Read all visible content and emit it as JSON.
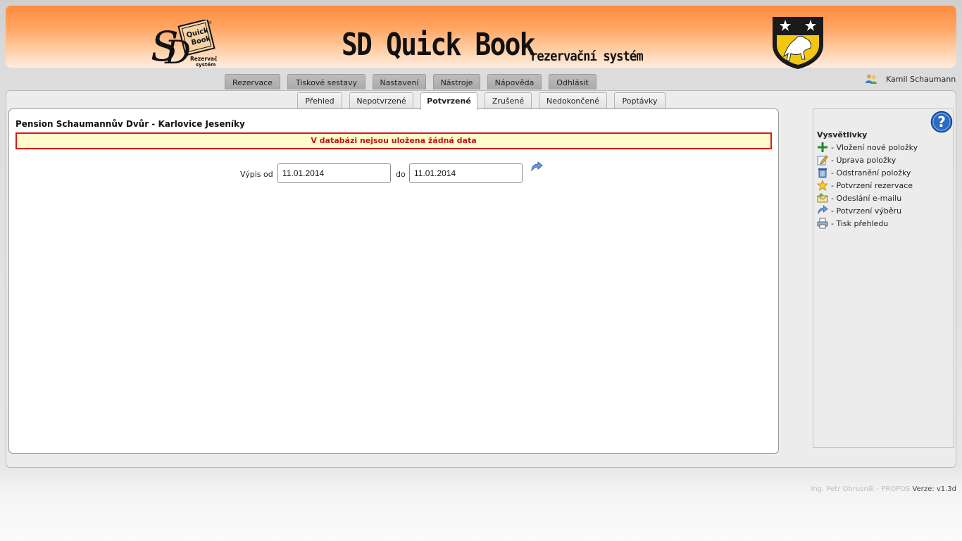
{
  "header": {
    "logo_text": "SD Quick Book Rezervační systém",
    "title": "SD Quick Book",
    "subtitle": "rezervační systém"
  },
  "nav": {
    "tabs": [
      "Rezervace",
      "Tiskové sestavy",
      "Nastavení",
      "Nástroje",
      "Nápověda",
      "Odhlásit"
    ]
  },
  "user": {
    "name": "Kamil Schaumann"
  },
  "subnav": {
    "tabs": [
      "Přehled",
      "Nepotvrzené",
      "Potvrzené",
      "Zrušené",
      "Nedokončené",
      "Poptávky"
    ],
    "active": "Potvrzené"
  },
  "main": {
    "pension": "Pension Schaumannův Dvůr - Karlovice Jeseníky",
    "message": "V databázi nejsou uložena žádná data",
    "range_label": "Výpis od",
    "to_label": "do",
    "date_from": "11.01.2014",
    "date_to": "11.01.2014"
  },
  "legend": {
    "title": "Vysvětlivky",
    "items": [
      {
        "icon": "plus-icon",
        "label": "- Vložení nové položky"
      },
      {
        "icon": "edit-icon",
        "label": "- Úprava položky"
      },
      {
        "icon": "trash-icon",
        "label": "- Odstranění položky"
      },
      {
        "icon": "star-icon",
        "label": "- Potvrzení rezervace"
      },
      {
        "icon": "email-icon",
        "label": "- Odeslání e-mailu"
      },
      {
        "icon": "confirm-arrow-icon",
        "label": "- Potvrzení výběru"
      },
      {
        "icon": "print-icon",
        "label": "- Tisk přehledu"
      }
    ]
  },
  "footer": {
    "author": "Ing. Petr Obrusník - PROPOS",
    "version": "Verze: v1.3d"
  },
  "colors": {
    "banner_orange": "#ff8a3d",
    "error_border": "#d61a1a",
    "error_bg": "#fffccb"
  }
}
